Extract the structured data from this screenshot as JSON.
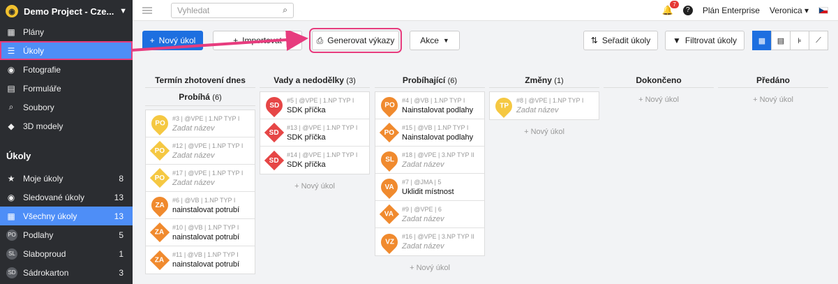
{
  "project": {
    "name": "Demo Project - Cze...",
    "logo_icon": "logo-icon"
  },
  "nav": [
    {
      "label": "Plány",
      "icon": "plans-icon",
      "glyph": "▦"
    },
    {
      "label": "Úkoly",
      "icon": "list-icon",
      "glyph": "☰"
    },
    {
      "label": "Fotografie",
      "icon": "camera-icon",
      "glyph": "◉"
    },
    {
      "label": "Formuláře",
      "icon": "clipboard-icon",
      "glyph": "▤"
    },
    {
      "label": "Soubory",
      "icon": "paperclip-icon",
      "glyph": "⌕"
    },
    {
      "label": "3D modely",
      "icon": "cube-icon",
      "glyph": "◆"
    }
  ],
  "tasks_section": {
    "title": "Úkoly",
    "items": [
      {
        "label": "Moje úkoly",
        "count": "8",
        "glyph": "★"
      },
      {
        "label": "Sledované úkoly",
        "count": "13",
        "glyph": "◉"
      },
      {
        "label": "Všechny úkoly",
        "count": "13",
        "glyph": "▦"
      },
      {
        "label": "Podlahy",
        "count": "5",
        "avatar": "PO"
      },
      {
        "label": "Slaboproud",
        "count": "1",
        "avatar": "SL"
      },
      {
        "label": "Sádrokarton",
        "count": "3",
        "avatar": "SD"
      }
    ]
  },
  "topbar": {
    "search_placeholder": "Vyhledat",
    "notifications": "7",
    "help": "?",
    "plan": "Plán Enterprise",
    "user": "Veronica",
    "user_caret": "▾"
  },
  "toolbar": {
    "new_task": "Nový úkol",
    "import": "Importovat",
    "generate": "Generovat výkazy",
    "actions": "Akce",
    "sort": "Seřadit úkoly",
    "filter": "Filtrovat úkoly"
  },
  "colors": {
    "accent": "#1d6fe0",
    "highlight": "#e73c7e",
    "yellow": "#f5c842",
    "orange": "#f08a2e",
    "red": "#e64646"
  },
  "add_task": "+ Nový úkol",
  "columns": [
    {
      "title": "Termín zhotovení dnes",
      "count": "",
      "subheader": "Probíhá",
      "sub_count": "(6)",
      "cards": [
        {
          "badge": "PO",
          "shape": "pin",
          "color": "yellow",
          "meta": "#3 | @VPE | 1.NP TYP I",
          "title": "Zadat název",
          "placeholder": true
        },
        {
          "badge": "PO",
          "shape": "dia",
          "color": "yellow",
          "meta": "#12 | @VPE | 1.NP TYP I",
          "title": "Zadat název",
          "placeholder": true
        },
        {
          "badge": "PO",
          "shape": "dia",
          "color": "yellow",
          "meta": "#17 | @VPE | 1.NP TYP I",
          "title": "Zadat název",
          "placeholder": true
        },
        {
          "badge": "ZA",
          "shape": "pin",
          "color": "orange",
          "meta": "#6 | @VB | 1.NP TYP I",
          "title": "nainstalovat potrubí",
          "placeholder": false
        },
        {
          "badge": "ZA",
          "shape": "dia",
          "color": "orange",
          "meta": "#10 | @VB | 1.NP TYP I",
          "title": "nainstalovat potrubí",
          "placeholder": false
        },
        {
          "badge": "ZA",
          "shape": "dia",
          "color": "orange",
          "meta": "#11 | @VB | 1.NP TYP I",
          "title": "nainstalovat potrubí",
          "placeholder": false
        }
      ]
    },
    {
      "title": "Vady a nedodělky",
      "count": "(3)",
      "cards": [
        {
          "badge": "SD",
          "shape": "pin",
          "color": "red",
          "meta": "#5 | @VPE | 1.NP TYP I",
          "title": "SDK příčka",
          "placeholder": false
        },
        {
          "badge": "SD",
          "shape": "dia",
          "color": "red",
          "meta": "#13 | @VPE | 1.NP TYP I",
          "title": "SDK příčka",
          "placeholder": false
        },
        {
          "badge": "SD",
          "shape": "dia",
          "color": "red",
          "meta": "#14 | @VPE | 1.NP TYP I",
          "title": "SDK příčka",
          "placeholder": false
        }
      ],
      "add": true
    },
    {
      "title": "Probíhající",
      "count": "(6)",
      "cards": [
        {
          "badge": "PO",
          "shape": "pin",
          "color": "orange",
          "meta": "#4 | @VB | 1.NP TYP I",
          "title": "Nainstalovat podlahy",
          "placeholder": false
        },
        {
          "badge": "PO",
          "shape": "dia",
          "color": "orange",
          "meta": "#15 | @VB | 1.NP TYP I",
          "title": "Nainstalovat podlahy",
          "placeholder": false
        },
        {
          "badge": "SL",
          "shape": "pin",
          "color": "orange",
          "meta": "#18 | @VPE | 3.NP TYP II",
          "title": "Zadat název",
          "placeholder": true
        },
        {
          "badge": "VA",
          "shape": "pin",
          "color": "orange",
          "meta": "#7 | @JMA | 5",
          "title": "Uklidit místnost",
          "placeholder": false
        },
        {
          "badge": "VA",
          "shape": "dia",
          "color": "orange",
          "meta": "#9 | @VPE | 6",
          "title": "Zadat název",
          "placeholder": true
        },
        {
          "badge": "VZ",
          "shape": "pin",
          "color": "orange",
          "meta": "#16 | @VPE | 3.NP TYP II",
          "title": "Zadat název",
          "placeholder": true
        }
      ],
      "add": true
    },
    {
      "title": "Změny",
      "count": "(1)",
      "cards": [
        {
          "badge": "TP",
          "shape": "pin",
          "color": "yellow",
          "meta": "#8 | @VPE | 1.NP TYP I",
          "title": "Zadat název",
          "placeholder": true
        }
      ],
      "add": true
    },
    {
      "title": "Dokončeno",
      "count": "",
      "cards": [],
      "add": true
    },
    {
      "title": "Předáno",
      "count": "",
      "cards": [],
      "add": true
    }
  ]
}
